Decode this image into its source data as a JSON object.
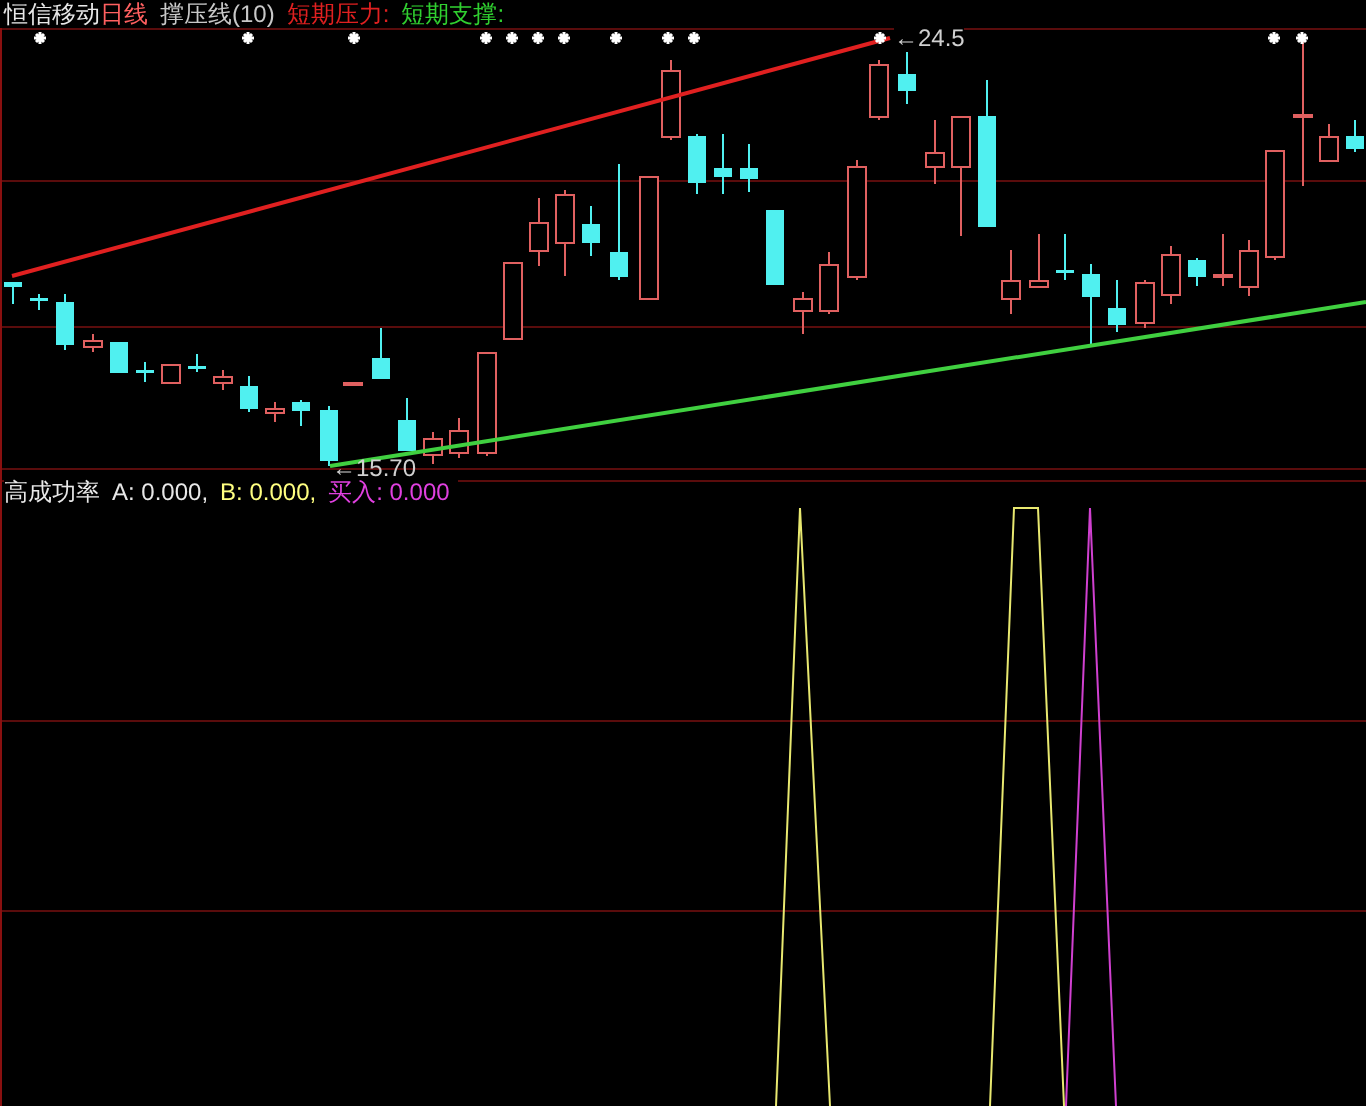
{
  "header": {
    "stock": "恒信移动",
    "period": "日线",
    "indicator": "撑压线(10)",
    "legend": [
      {
        "label": "短期压力:",
        "color": "#e02020"
      },
      {
        "label": "短期支撑:",
        "color": "#30d030"
      }
    ]
  },
  "main_chart": {
    "price_labels": [
      "←24.5",
      "←15.70"
    ]
  },
  "sub_chart": {
    "title": "高成功率",
    "values": [
      {
        "label": "A: 0.000,",
        "color": "#e8e8e8"
      },
      {
        "label": "B: 0.000,",
        "color": "#ffff80"
      },
      {
        "label": "买入: 0.000",
        "color": "#e040e0"
      }
    ]
  }
}
